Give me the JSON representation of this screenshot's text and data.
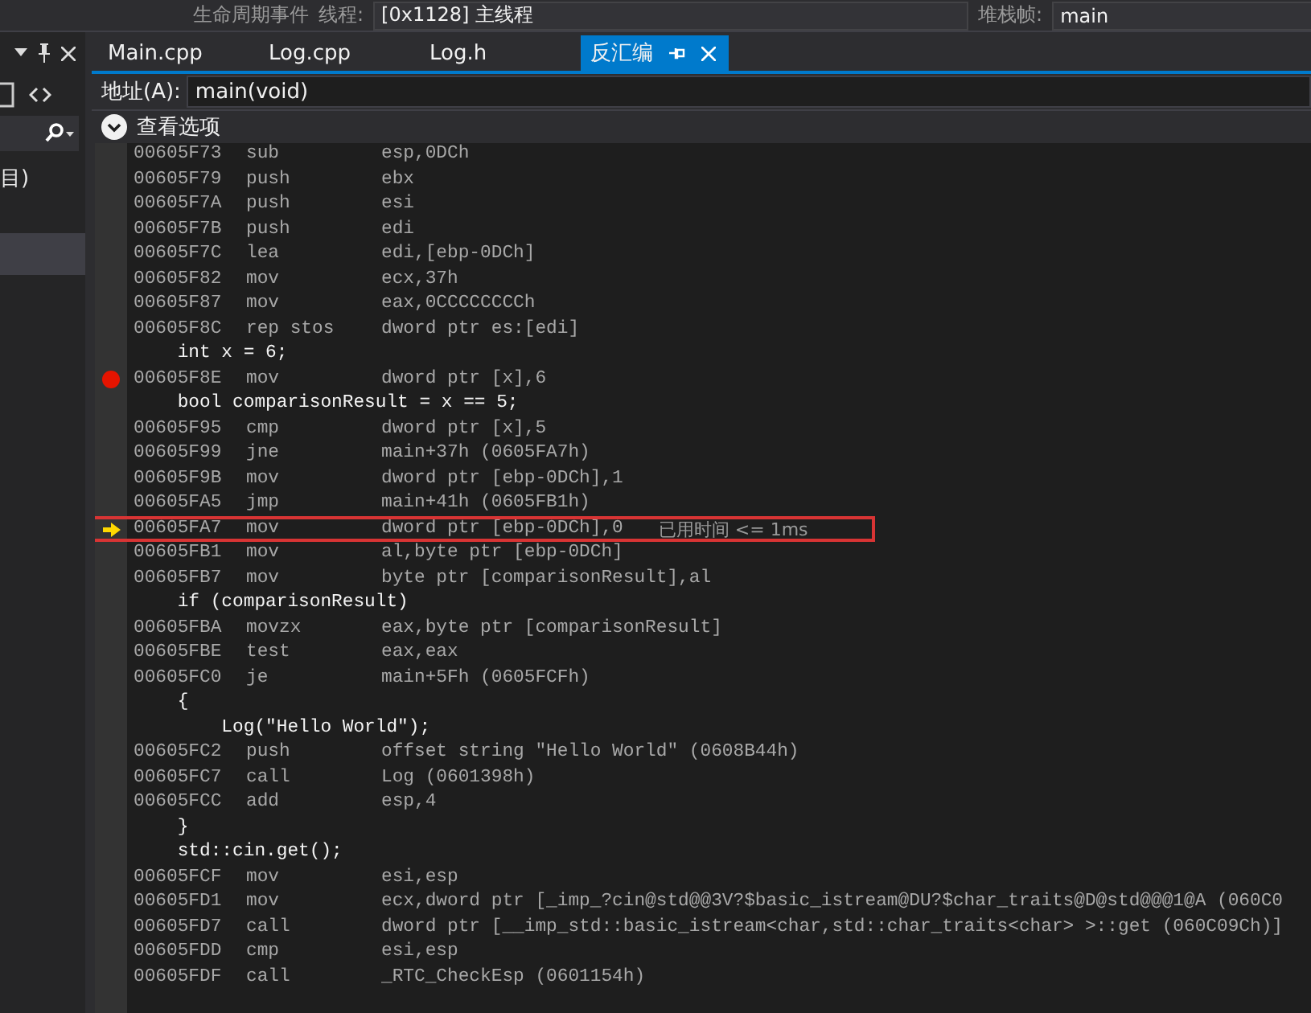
{
  "toolbar": {
    "lifecycle": "生命周期事件",
    "thread_label": "线程:",
    "thread": "[0x1128] 主线程",
    "frame_label": "堆栈帧:",
    "frame": "main"
  },
  "sidebar": {
    "text": "目)"
  },
  "tabs": [
    {
      "label": "Main.cpp",
      "selected": false
    },
    {
      "label": "Log.cpp",
      "selected": false
    },
    {
      "label": "Log.h",
      "selected": false
    },
    {
      "label": "反汇编",
      "selected": true
    }
  ],
  "address": {
    "label": "地址(A):",
    "value": "main(void)"
  },
  "view_options": "查看选项",
  "lines": [
    {
      "kind": "asm",
      "addr": "00605F73",
      "op": "sub",
      "arg": "esp,0DCh",
      "breakpoint": false,
      "current": false
    },
    {
      "kind": "asm",
      "addr": "00605F79",
      "op": "push",
      "arg": "ebx",
      "breakpoint": false,
      "current": false
    },
    {
      "kind": "asm",
      "addr": "00605F7A",
      "op": "push",
      "arg": "esi",
      "breakpoint": false,
      "current": false
    },
    {
      "kind": "asm",
      "addr": "00605F7B",
      "op": "push",
      "arg": "edi",
      "breakpoint": false,
      "current": false
    },
    {
      "kind": "asm",
      "addr": "00605F7C",
      "op": "lea",
      "arg": "edi,[ebp-0DCh]",
      "breakpoint": false,
      "current": false
    },
    {
      "kind": "asm",
      "addr": "00605F82",
      "op": "mov",
      "arg": "ecx,37h",
      "breakpoint": false,
      "current": false
    },
    {
      "kind": "asm",
      "addr": "00605F87",
      "op": "mov",
      "arg": "eax,0CCCCCCCCh",
      "breakpoint": false,
      "current": false
    },
    {
      "kind": "asm",
      "addr": "00605F8C",
      "op": "rep stos",
      "arg": "dword ptr es:[edi]",
      "breakpoint": false,
      "current": false
    },
    {
      "kind": "source",
      "text": "    int x = 6;"
    },
    {
      "kind": "asm",
      "addr": "00605F8E",
      "op": "mov",
      "arg": "dword ptr [x],6",
      "breakpoint": true,
      "current": false
    },
    {
      "kind": "source",
      "text": "    bool comparisonResult = x == 5;"
    },
    {
      "kind": "asm",
      "addr": "00605F95",
      "op": "cmp",
      "arg": "dword ptr [x],5",
      "breakpoint": false,
      "current": false
    },
    {
      "kind": "asm",
      "addr": "00605F99",
      "op": "jne",
      "arg": "main+37h (0605FA7h)",
      "breakpoint": false,
      "current": false
    },
    {
      "kind": "asm",
      "addr": "00605F9B",
      "op": "mov",
      "arg": "dword ptr [ebp-0DCh],1",
      "breakpoint": false,
      "current": false
    },
    {
      "kind": "asm",
      "addr": "00605FA5",
      "op": "jmp",
      "arg": "main+41h (0605FB1h)",
      "breakpoint": false,
      "current": false
    },
    {
      "kind": "asm",
      "addr": "00605FA7",
      "op": "mov",
      "arg": "dword ptr [ebp-0DCh],0",
      "breakpoint": false,
      "current": true,
      "note": "已用时间 <= 1ms"
    },
    {
      "kind": "asm",
      "addr": "00605FB1",
      "op": "mov",
      "arg": "al,byte ptr [ebp-0DCh]",
      "breakpoint": false,
      "current": false
    },
    {
      "kind": "asm",
      "addr": "00605FB7",
      "op": "mov",
      "arg": "byte ptr [comparisonResult],al",
      "breakpoint": false,
      "current": false
    },
    {
      "kind": "source",
      "text": "    if (comparisonResult)"
    },
    {
      "kind": "asm",
      "addr": "00605FBA",
      "op": "movzx",
      "arg": "eax,byte ptr [comparisonResult]",
      "breakpoint": false,
      "current": false
    },
    {
      "kind": "asm",
      "addr": "00605FBE",
      "op": "test",
      "arg": "eax,eax",
      "breakpoint": false,
      "current": false
    },
    {
      "kind": "asm",
      "addr": "00605FC0",
      "op": "je",
      "arg": "main+5Fh (0605FCFh)",
      "breakpoint": false,
      "current": false
    },
    {
      "kind": "source",
      "text": "    {"
    },
    {
      "kind": "source",
      "text": "        Log(\"Hello World\");"
    },
    {
      "kind": "asm",
      "addr": "00605FC2",
      "op": "push",
      "arg": "offset string \"Hello World\" (0608B44h)",
      "breakpoint": false,
      "current": false
    },
    {
      "kind": "asm",
      "addr": "00605FC7",
      "op": "call",
      "arg": "Log (0601398h)",
      "breakpoint": false,
      "current": false
    },
    {
      "kind": "asm",
      "addr": "00605FCC",
      "op": "add",
      "arg": "esp,4",
      "breakpoint": false,
      "current": false
    },
    {
      "kind": "source",
      "text": "    }"
    },
    {
      "kind": "source",
      "text": "    std::cin.get();"
    },
    {
      "kind": "asm",
      "addr": "00605FCF",
      "op": "mov",
      "arg": "esi,esp",
      "breakpoint": false,
      "current": false
    },
    {
      "kind": "asm",
      "addr": "00605FD1",
      "op": "mov",
      "arg": "ecx,dword ptr [_imp_?cin@std@@3V?$basic_istream@DU?$char_traits@D@std@@@1@A (060C0",
      "breakpoint": false,
      "current": false
    },
    {
      "kind": "asm",
      "addr": "00605FD7",
      "op": "call",
      "arg": "dword ptr [__imp_std::basic_istream<char,std::char_traits<char> >::get (060C09Ch)]",
      "breakpoint": false,
      "current": false
    },
    {
      "kind": "asm",
      "addr": "00605FDD",
      "op": "cmp",
      "arg": "esi,esp",
      "breakpoint": false,
      "current": false
    },
    {
      "kind": "asm",
      "addr": "00605FDF",
      "op": "call",
      "arg": "_RTC_CheckEsp (0601154h)",
      "breakpoint": false,
      "current": false
    }
  ]
}
